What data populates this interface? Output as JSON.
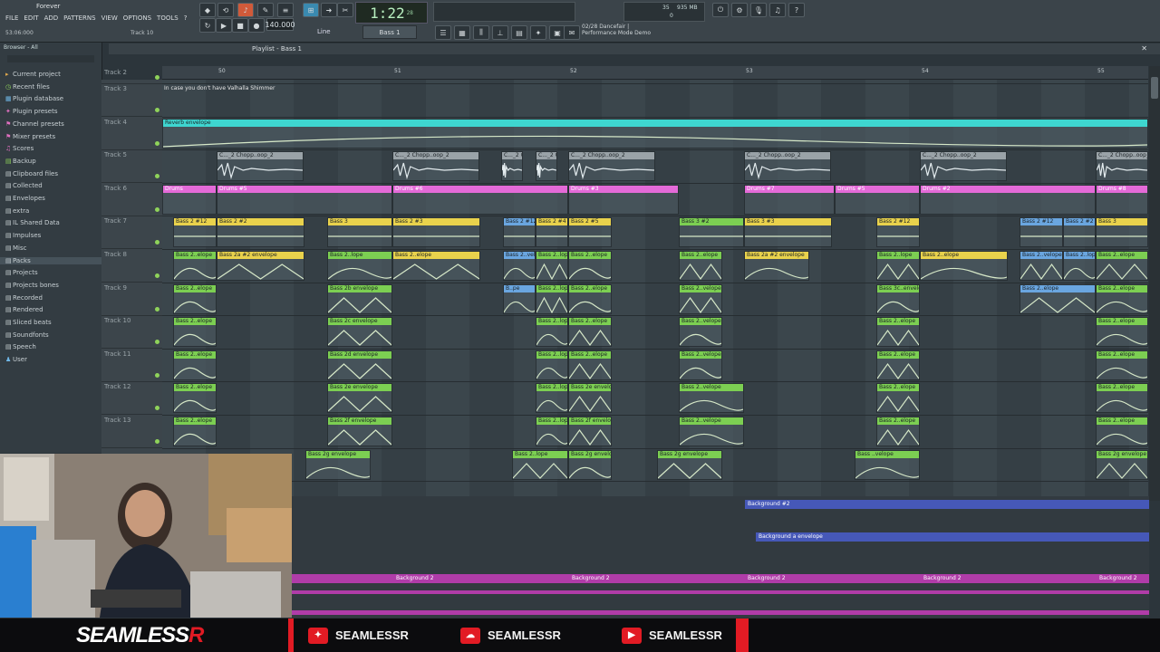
{
  "window": {
    "title": "Forever"
  },
  "menu": [
    "FILE",
    "EDIT",
    "ADD",
    "PATTERNS",
    "VIEW",
    "OPTIONS",
    "TOOLS",
    "?"
  ],
  "status": {
    "song_position": "53:06:000",
    "hint_track": "Track 10"
  },
  "transport": {
    "tempo": "140.000",
    "time": "1:22",
    "time_small": "28",
    "mode": "Line",
    "pattern": "Bass 1"
  },
  "cpu": {
    "value": "35",
    "memory": "935 MB",
    "polyphony": "0"
  },
  "news": {
    "line1": "02/28 Dancefair |",
    "line2": "Performance Mode Demo"
  },
  "browser": {
    "header": "Browser - All",
    "items": [
      "Current project",
      "Recent files",
      "Plugin database",
      "Plugin presets",
      "Channel presets",
      "Mixer presets",
      "Scores",
      "Backup",
      "Clipboard files",
      "Collected",
      "Envelopes",
      "extra",
      "IL Shared Data",
      "Impulses",
      "Misc",
      "Packs",
      "Projects",
      "Projects bones",
      "Recorded",
      "Rendered",
      "Sliced beats",
      "Soundfonts",
      "Speech",
      "User"
    ]
  },
  "playlist": {
    "title": "Playlist - Bass 1",
    "ruler": [
      "50",
      "51",
      "52",
      "53",
      "54",
      "55"
    ],
    "top_note": "In case you don't have Valhalla Shimmer",
    "tracks": [
      "Track 2",
      "Track 3",
      "Track 4",
      "Track 5",
      "Track 6",
      "Track 7",
      "Track 8",
      "Track 9",
      "Track 10",
      "Track 11",
      "Track 12",
      "Track 13"
    ],
    "clips": {
      "reverb": "Reverb envelope",
      "chop": "C..._2 Chopp..oop_2",
      "drums": [
        "Drums",
        "Drums #5",
        "Drums #6",
        "Drums #3",
        "Drums #7",
        "Drums #5",
        "Drums #2",
        "Drums #8"
      ],
      "bass7": [
        "Bass 2 #12",
        "Bass 2 #2",
        "Bass 3",
        "Bass 2 #3",
        "Bass 2 #12",
        "Bass 2 #4",
        "Bass 2 #5",
        "Bass 3 #2",
        "Bass 3 #3",
        "Bass 2 #12"
      ],
      "env8": [
        "Bass 2..elope",
        "Bass 2a #2 envelope",
        "Bass 2..lope",
        "Bass 2..elope",
        "Bass 2..velope",
        "Bass 2..lope",
        "Bass 2..elope"
      ],
      "env9": [
        "Bass 2..elope",
        "Bass 2b envelope",
        "B..pe",
        "Bass 2..lope",
        "Bass 2..elope",
        "Bass 2..velope",
        "Bass 3c..envelope",
        "Bass 2..elope"
      ],
      "env10": [
        "Bass 2..elope",
        "Bass 2c envelope",
        "Bass 2..lope",
        "Bass 2..elope",
        "Bass 2..velope",
        "Bass 2..elope"
      ],
      "env11": [
        "Bass 2..elope",
        "Bass 2d envelope",
        "Bass 2..lope",
        "Bass 2..elope",
        "Bass 2..velope",
        "Bass 2..elope"
      ],
      "env12": [
        "Bass 2..elope",
        "Bass 2e envelope",
        "Bass 2..lope",
        "Bass 2e envelope",
        "Bass 2..velope",
        "Bass 2..elope"
      ],
      "env13": [
        "Bass 2..elope",
        "Bass 2f envelope",
        "Bass 2..lope",
        "Bass 2f envelope",
        "Bass 2..velope",
        "Bass 2..elope"
      ],
      "env14": [
        "Bass 2g envelope",
        "Bass 2..lope",
        "Bass 2g envelope",
        "Bass 2g envelope",
        "Bass ..velope"
      ]
    },
    "background": {
      "pattern2": "Background #2",
      "envelope": "Background a envelope",
      "clip": "Background 2"
    }
  },
  "social": {
    "twitter": "SEAMLESSR",
    "soundcloud": "SEAMLESSR",
    "youtube": "SEAMLESSR",
    "logo": "SEAMLESS",
    "logo_r": "R"
  }
}
